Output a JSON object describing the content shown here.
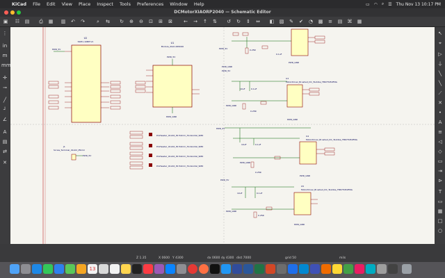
{
  "menubar": {
    "apple_icon": "apple-icon",
    "app": "KiCad",
    "items": [
      "File",
      "Edit",
      "View",
      "Place",
      "Inspect",
      "Tools",
      "Preferences",
      "Window",
      "Help"
    ],
    "clock": "Thu Nov 13  10:17 PM"
  },
  "window": {
    "title": "DCMotorXIAORP2040 — Schematic Editor"
  },
  "status": {
    "zoom": "Z 1.35",
    "x": "X 0600",
    "y": "Y 4300",
    "dx": "dx 0600",
    "dy": "dy 4300",
    "dist": "dist 7000",
    "grid": "grid 50",
    "units": "mils"
  },
  "schematic": {
    "u2": {
      "ref": "U2",
      "value": "SSPI1-10BIT-V1"
    },
    "u1": {
      "ref": "U1",
      "value": "Module_XIAO-RP2040"
    },
    "j_screw": {
      "ref": "J1",
      "value": "Screw_Terminal_01x02_P5mm"
    },
    "pinheaders": [
      "PinHeader_01x02_P2.54mm_Horizontal_SMD",
      "PinHeader_01x02_P2.54mm_Horizontal_SMD",
      "PinHeader_01x02_P2.54mm_Horizontal_SMD",
      "PinHeader_01x02_P2.54mm_Horizontal_SMD"
    ],
    "drivers": [
      {
        "ref": "U3",
        "value": "MotorDriver_Brushed_DC_Toshiba_TB67H450FNG"
      },
      {
        "ref": "U4",
        "value": "MotorDriver_Brushed_DC_Toshiba_TB67H450FNG"
      },
      {
        "ref": "U5",
        "value": "MotorDriver_Brushed_DC_Toshiba_TB67H450FNG"
      },
      {
        "ref": "U6",
        "value": "MotorDriver_Brushed_DC_Toshiba_TB67H450FNG"
      }
    ],
    "net_pwr": "PWR_5V",
    "net_gnd": "PWR_GND",
    "cap": "10uF",
    "cap2": "0.1uF",
    "res": "0.25R"
  },
  "dock": {
    "apps": [
      "finder",
      "launchpad",
      "safari",
      "messages",
      "mail",
      "maps",
      "photos",
      "facetime",
      "calendar",
      "contacts",
      "reminders",
      "notes",
      "tv",
      "music",
      "podcasts",
      "appstore",
      "settings",
      "chrome",
      "firefox",
      "terminal",
      "vscode",
      "kicad",
      "word",
      "excel",
      "powerpoint",
      "preview",
      "xcode",
      "trash"
    ],
    "calendar_day": "13"
  }
}
